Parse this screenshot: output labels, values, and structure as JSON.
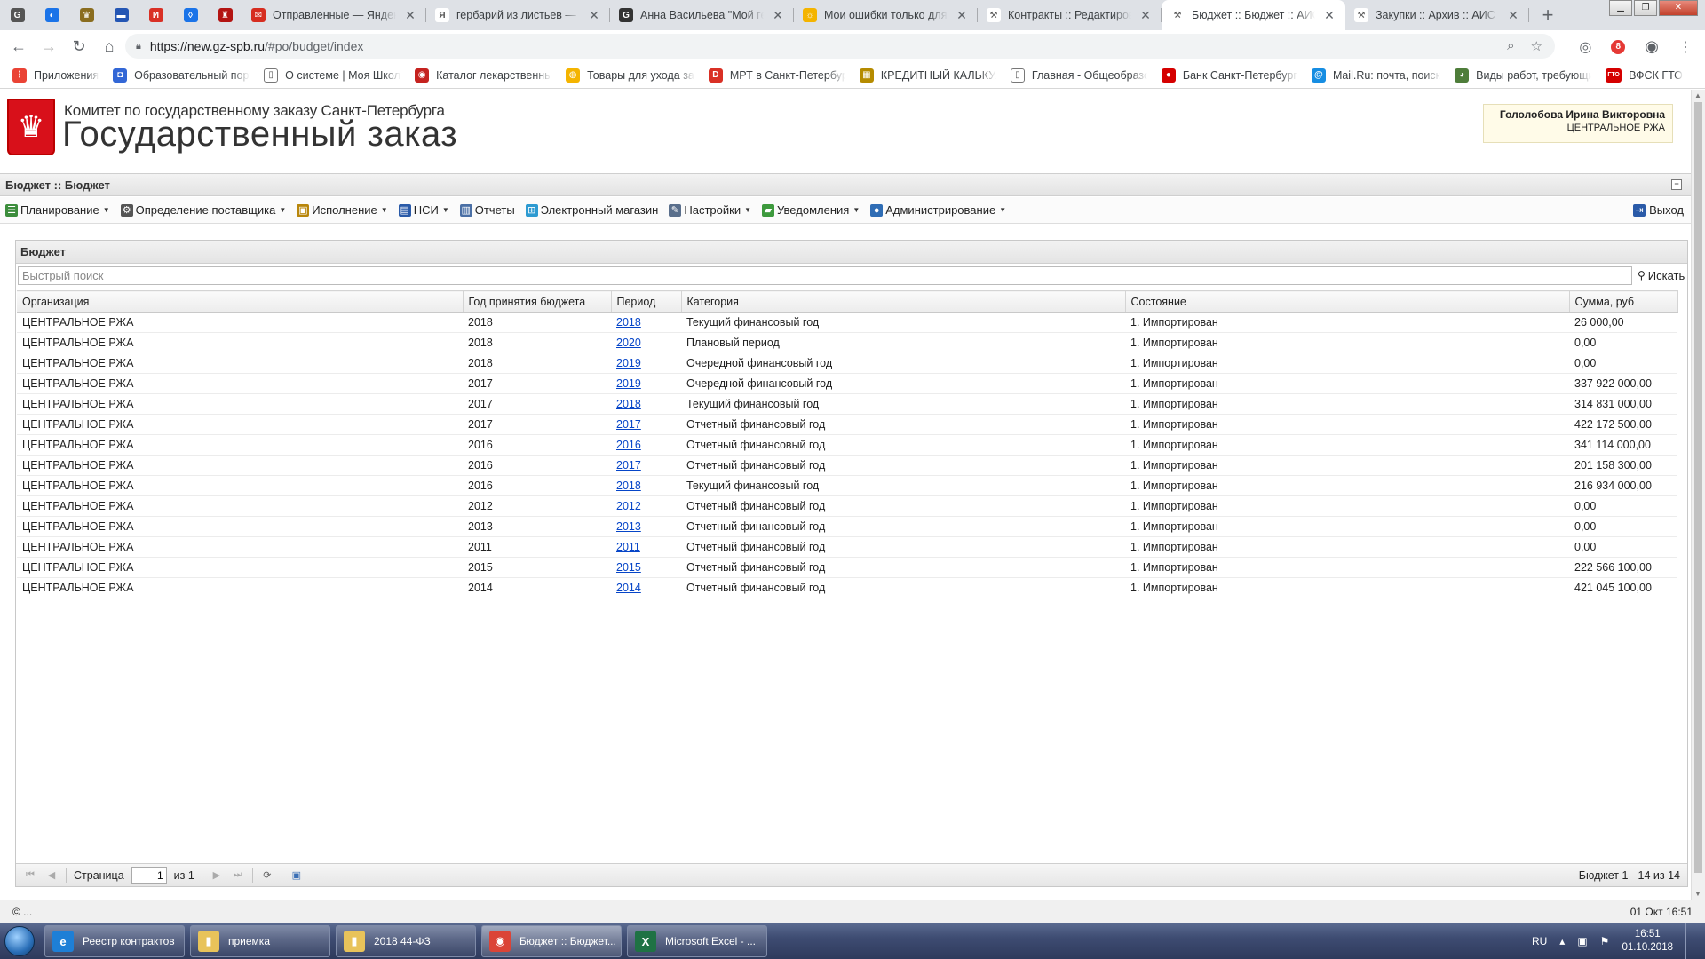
{
  "browser": {
    "tabs": [
      {
        "title": "Отправленные — Яндекс.Почта",
        "icon": "mail-icon",
        "color": "#d62d20",
        "glyph": "✉",
        "active": false
      },
      {
        "title": "гербарий из листьев — Яндекс",
        "icon": "yandex-icon",
        "color": "#ffffff",
        "glyph": "Я",
        "active": false
      },
      {
        "title": "Анна Васильева \"Мой гербарий\"",
        "icon": "site-icon",
        "color": "#333333",
        "glyph": "G",
        "active": false
      },
      {
        "title": "Мои ошибки только для друзей",
        "icon": "sun-icon",
        "color": "#f4b400",
        "glyph": "☼",
        "active": false
      },
      {
        "title": "Контракты :: Редактирование",
        "icon": "hammer-icon",
        "color": "#ffffff",
        "glyph": "⚒",
        "active": false
      },
      {
        "title": "Бюджет :: Бюджет :: АИС ГЗ",
        "icon": "hammer-icon",
        "color": "#ffffff",
        "glyph": "⚒",
        "active": true
      },
      {
        "title": "Закупки :: Архив :: АИС ГЗ",
        "icon": "hammer-icon",
        "color": "#ffffff",
        "glyph": "⚒",
        "active": false
      }
    ],
    "pinned_icons": [
      {
        "name": "chrome-icon",
        "color": "#555555",
        "glyph": "G"
      },
      {
        "name": "shield-icon",
        "color": "#1a73e8",
        "glyph": "◐"
      },
      {
        "name": "coat-of-arms-icon",
        "color": "#8a6d1f",
        "glyph": "♛"
      },
      {
        "name": "flag-icon",
        "color": "#2456b4",
        "glyph": "▬"
      },
      {
        "name": "cert-icon",
        "color": "#d93025",
        "glyph": "И"
      },
      {
        "name": "drop-icon",
        "color": "#1a73e8",
        "glyph": "◊"
      },
      {
        "name": "spb-emblem-icon",
        "color": "#b31412",
        "glyph": "♜"
      }
    ],
    "url_host": "https://new.gz-spb.ru",
    "url_path": "/#po/budget/index",
    "extension_badge": "8"
  },
  "bookmarks": [
    {
      "label": "Приложения",
      "icon": "apps-grid-icon",
      "color": "#ea4335",
      "glyph": "⋮"
    },
    {
      "label": "Образовательный портал",
      "icon": "edu-icon",
      "color": "#3367d6",
      "glyph": "◘"
    },
    {
      "label": "О системе | Моя Школа",
      "icon": "page-icon",
      "color": "#ffffff",
      "glyph": "▯"
    },
    {
      "label": "Каталог лекарственных",
      "icon": "catalog-icon",
      "color": "#c5221f",
      "glyph": "◉"
    },
    {
      "label": "Товары для ухода за",
      "icon": "rainbow-icon",
      "color": "#f4b400",
      "glyph": "◍"
    },
    {
      "label": "МРТ в Санкт-Петербурге",
      "icon": "mrt-icon",
      "color": "#d93025",
      "glyph": "D"
    },
    {
      "label": "КРЕДИТНЫЙ КАЛЬКУЛЯТОР",
      "icon": "calc-icon",
      "color": "#b58b00",
      "glyph": "▦"
    },
    {
      "label": "Главная - Общеобразовательная",
      "icon": "page-icon",
      "color": "#ffffff",
      "glyph": "▯"
    },
    {
      "label": "Банк Санкт-Петербург",
      "icon": "bank-icon",
      "color": "#d50000",
      "glyph": "●"
    },
    {
      "label": "Mail.Ru: почта, поиск",
      "icon": "mailru-icon",
      "color": "#168de2",
      "glyph": "@"
    },
    {
      "label": "Виды работ, требующих",
      "icon": "globe-icon",
      "color": "#4e7d3a",
      "glyph": "◕"
    },
    {
      "label": "ВФСК ГТО",
      "icon": "gto-icon",
      "color": "#d50000",
      "glyph": "ГТО"
    }
  ],
  "header": {
    "org_line1": "Комитет по государственному заказу Санкт-Петербурга",
    "org_line2": "Государственный заказ",
    "user_name": "Гололобова Ирина Викторовна",
    "user_org": "ЦЕНТРАЛЬНОЕ РЖА"
  },
  "title_bar": "Бюджет :: Бюджет",
  "menu": [
    {
      "label": "Планирование",
      "icon": "planning-icon",
      "color": "#3c8d3c",
      "glyph": "☰",
      "dropdown": true
    },
    {
      "label": "Определение поставщика",
      "icon": "gears-icon",
      "color": "#555555",
      "glyph": "⚙",
      "dropdown": true
    },
    {
      "label": "Исполнение",
      "icon": "boxes-icon",
      "color": "#b8860b",
      "glyph": "▣",
      "dropdown": true
    },
    {
      "label": "НСИ",
      "icon": "directory-icon",
      "color": "#2a5aa8",
      "glyph": "▤",
      "dropdown": true
    },
    {
      "label": "Отчеты",
      "icon": "report-icon",
      "color": "#4a6fa5",
      "glyph": "▥",
      "dropdown": false
    },
    {
      "label": "Электронный магазин",
      "icon": "cart-icon",
      "color": "#2d9ad1",
      "glyph": "⊞",
      "dropdown": false
    },
    {
      "label": "Настройки",
      "icon": "wrench-icon",
      "color": "#5a6f8c",
      "glyph": "✎",
      "dropdown": true
    },
    {
      "label": "Уведомления",
      "icon": "bell-box-icon",
      "color": "#3d9a3d",
      "glyph": "▰",
      "dropdown": true
    },
    {
      "label": "Администрирование",
      "icon": "user-admin-icon",
      "color": "#2f6db5",
      "glyph": "●",
      "dropdown": true
    }
  ],
  "logout_label": "Выход",
  "panel": {
    "title": "Бюджет",
    "search_placeholder": "Быстрый поиск",
    "search_button": "Искать"
  },
  "table": {
    "columns": [
      "Организация",
      "Год принятия бюджета",
      "Период",
      "Категория",
      "Состояние",
      "Сумма, руб"
    ],
    "rows": [
      [
        "ЦЕНТРАЛЬНОЕ РЖА",
        "2018",
        "2018",
        "Текущий финансовый год",
        "1. Импортирован",
        "26 000,00"
      ],
      [
        "ЦЕНТРАЛЬНОЕ РЖА",
        "2018",
        "2020",
        "Плановый период",
        "1. Импортирован",
        "0,00"
      ],
      [
        "ЦЕНТРАЛЬНОЕ РЖА",
        "2018",
        "2019",
        "Очередной финансовый год",
        "1. Импортирован",
        "0,00"
      ],
      [
        "ЦЕНТРАЛЬНОЕ РЖА",
        "2017",
        "2019",
        "Очередной финансовый год",
        "1. Импортирован",
        "337 922 000,00"
      ],
      [
        "ЦЕНТРАЛЬНОЕ РЖА",
        "2017",
        "2018",
        "Текущий финансовый год",
        "1. Импортирован",
        "314 831 000,00"
      ],
      [
        "ЦЕНТРАЛЬНОЕ РЖА",
        "2017",
        "2017",
        "Отчетный финансовый год",
        "1. Импортирован",
        "422 172 500,00"
      ],
      [
        "ЦЕНТРАЛЬНОЕ РЖА",
        "2016",
        "2016",
        "Отчетный финансовый год",
        "1. Импортирован",
        "341 114 000,00"
      ],
      [
        "ЦЕНТРАЛЬНОЕ РЖА",
        "2016",
        "2017",
        "Отчетный финансовый год",
        "1. Импортирован",
        "201 158 300,00"
      ],
      [
        "ЦЕНТРАЛЬНОЕ РЖА",
        "2016",
        "2018",
        "Текущий финансовый год",
        "1. Импортирован",
        "216 934 000,00"
      ],
      [
        "ЦЕНТРАЛЬНОЕ РЖА",
        "2012",
        "2012",
        "Отчетный финансовый год",
        "1. Импортирован",
        "0,00"
      ],
      [
        "ЦЕНТРАЛЬНОЕ РЖА",
        "2013",
        "2013",
        "Отчетный финансовый год",
        "1. Импортирован",
        "0,00"
      ],
      [
        "ЦЕНТРАЛЬНОЕ РЖА",
        "2011",
        "2011",
        "Отчетный финансовый год",
        "1. Импортирован",
        "0,00"
      ],
      [
        "ЦЕНТРАЛЬНОЕ РЖА",
        "2015",
        "2015",
        "Отчетный финансовый год",
        "1. Импортирован",
        "222 566 100,00"
      ],
      [
        "ЦЕНТРАЛЬНОЕ РЖА",
        "2014",
        "2014",
        "Отчетный финансовый год",
        "1. Импортирован",
        "421 045 100,00"
      ]
    ]
  },
  "pager": {
    "page_label": "Страница",
    "page_value": "1",
    "of_label": "из 1",
    "info": "Бюджет 1 - 14 из 14"
  },
  "statusbar": {
    "left": "© ...",
    "right": "01 Окт 16:51"
  },
  "taskbar": {
    "tasks": [
      {
        "label": "Реестр контрактов",
        "icon": "ie-icon",
        "color": "#1e7fd6",
        "glyph": "e",
        "active": false
      },
      {
        "label": "приемка",
        "icon": "folder-icon",
        "color": "#e8c35a",
        "glyph": "▮",
        "active": false
      },
      {
        "label": "2018 44-ФЗ",
        "icon": "folder-icon",
        "color": "#e8c35a",
        "glyph": "▮",
        "active": false
      },
      {
        "label": "Бюджет :: Бюджет...",
        "icon": "chrome-icon",
        "color": "#db4437",
        "glyph": "◉",
        "active": true
      },
      {
        "label": "Microsoft Excel - ...",
        "icon": "excel-icon",
        "color": "#1f7244",
        "glyph": "X",
        "active": false
      }
    ],
    "lang": "RU",
    "time": "16:51",
    "date": "01.10.2018"
  }
}
